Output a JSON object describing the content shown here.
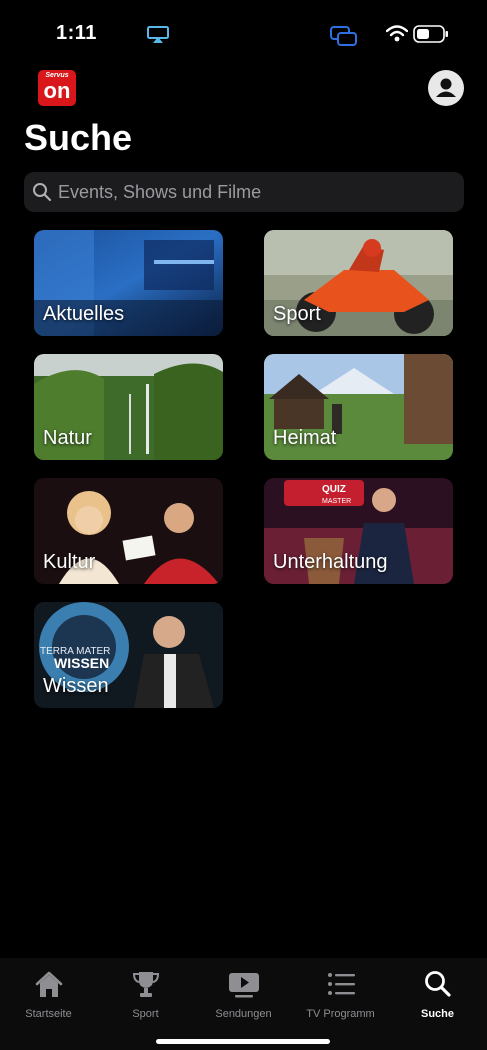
{
  "status_bar": {
    "time": "1:11",
    "icons": [
      "airplay-icon",
      "screen-mirroring-icon",
      "wifi-icon",
      "battery-icon"
    ]
  },
  "header": {
    "logo_small": "Servus",
    "logo_text": "on",
    "profile_icon": "person-icon"
  },
  "page_title": "Suche",
  "search": {
    "placeholder": "Events, Shows und Filme",
    "icon": "search-icon"
  },
  "categories": [
    {
      "label": "Aktuelles"
    },
    {
      "label": "Sport"
    },
    {
      "label": "Natur"
    },
    {
      "label": "Heimat"
    },
    {
      "label": "Kultur"
    },
    {
      "label": "Unterhaltung"
    },
    {
      "label": "Wissen"
    }
  ],
  "tile_text": {
    "quiz_line1": "QUIZ",
    "quiz_line2": "MASTER",
    "wissen_line1": "TERRA MATER",
    "wissen_line2": "WISSEN"
  },
  "tabbar": {
    "tabs": [
      {
        "label": "Startseite",
        "icon": "home-icon"
      },
      {
        "label": "Sport",
        "icon": "trophy-icon"
      },
      {
        "label": "Sendungen",
        "icon": "play-icon"
      },
      {
        "label": "TV Programm",
        "icon": "list-icon"
      },
      {
        "label": "Suche",
        "icon": "search-icon"
      }
    ],
    "active_index": 4
  },
  "colors": {
    "background": "#000000",
    "brand_red": "#d9171a",
    "search_bg": "#1c1c1e",
    "inactive_tab": "#8e8e93"
  }
}
